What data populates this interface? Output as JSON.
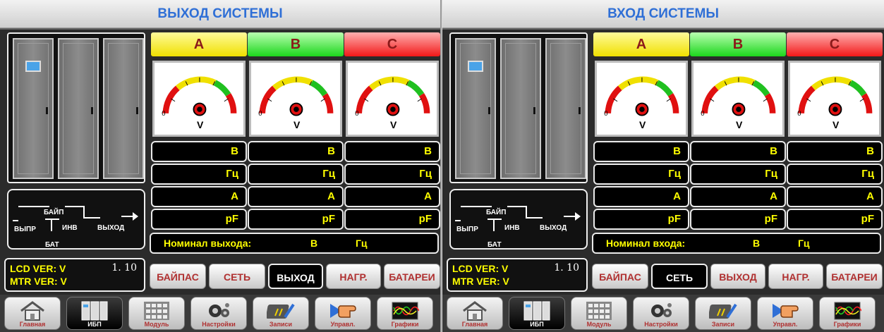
{
  "panels": [
    {
      "title": "ВЫХОД СИСТЕМЫ",
      "phases": [
        "A",
        "B",
        "C"
      ],
      "gauge": {
        "zero": "0",
        "unit": "V"
      },
      "value_rows": [
        [
          "В",
          "В",
          "В"
        ],
        [
          "Гц",
          "Гц",
          "Гц"
        ],
        [
          "A",
          "A",
          "A"
        ],
        [
          "pF",
          "pF",
          "pF"
        ]
      ],
      "nominal": {
        "label": "Номинал выхода:",
        "unit_v": "В",
        "unit_hz": "Гц"
      },
      "flow": {
        "bypass": "БАЙП",
        "rect": "ВЫПР",
        "inv": "ИНВ",
        "out": "ВЫХОД",
        "bat": "БАТ"
      },
      "version": {
        "lcd": "LCD VER: V",
        "mtr": "MTR VER: V",
        "num": "1. 10"
      },
      "tabs": [
        {
          "label": "БАЙПАС",
          "active": false
        },
        {
          "label": "СЕТЬ",
          "active": false
        },
        {
          "label": "ВЫХОД",
          "active": true
        },
        {
          "label": "НАГР.",
          "active": false
        },
        {
          "label": "БАТАРЕИ",
          "active": false
        }
      ],
      "nav": [
        {
          "label": "Главная",
          "icon": "home-icon"
        },
        {
          "label": "ИБП",
          "icon": "ups-icon",
          "active": true
        },
        {
          "label": "Модуль",
          "icon": "module-icon"
        },
        {
          "label": "Настройки",
          "icon": "gears-icon"
        },
        {
          "label": "Записи",
          "icon": "records-icon"
        },
        {
          "label": "Управл.",
          "icon": "control-hand-icon"
        },
        {
          "label": "Графики",
          "icon": "waveform-icon"
        }
      ]
    },
    {
      "title": "ВХОД СИСТЕМЫ",
      "phases": [
        "A",
        "B",
        "C"
      ],
      "gauge": {
        "zero": "0",
        "unit": "V"
      },
      "value_rows": [
        [
          "В",
          "В",
          "В"
        ],
        [
          "Гц",
          "Гц",
          "Гц"
        ],
        [
          "A",
          "A",
          "A"
        ],
        [
          "pF",
          "pF",
          "pF"
        ]
      ],
      "nominal": {
        "label": "Номинал входа:",
        "unit_v": "В",
        "unit_hz": "Гц"
      },
      "flow": {
        "bypass": "БАЙП",
        "rect": "ВЫПР",
        "inv": "ИНВ",
        "out": "ВЫХОД",
        "bat": "БАТ"
      },
      "version": {
        "lcd": "LCD VER: V",
        "mtr": "MTR VER: V",
        "num": "1. 10"
      },
      "tabs": [
        {
          "label": "БАЙПАС",
          "active": false
        },
        {
          "label": "СЕТЬ",
          "active": true
        },
        {
          "label": "ВЫХОД",
          "active": false
        },
        {
          "label": "НАГР.",
          "active": false
        },
        {
          "label": "БАТАРЕИ",
          "active": false
        }
      ],
      "nav": [
        {
          "label": "Главная",
          "icon": "home-icon"
        },
        {
          "label": "ИБП",
          "icon": "ups-icon",
          "active": true
        },
        {
          "label": "Модуль",
          "icon": "module-icon"
        },
        {
          "label": "Настройки",
          "icon": "gears-icon"
        },
        {
          "label": "Записи",
          "icon": "records-icon"
        },
        {
          "label": "Управл.",
          "icon": "control-hand-icon"
        },
        {
          "label": "Графики",
          "icon": "waveform-icon"
        }
      ]
    }
  ],
  "colors": {
    "title": "#2f6fd6",
    "value_text": "#ffff00",
    "tab_text": "#b03030"
  }
}
